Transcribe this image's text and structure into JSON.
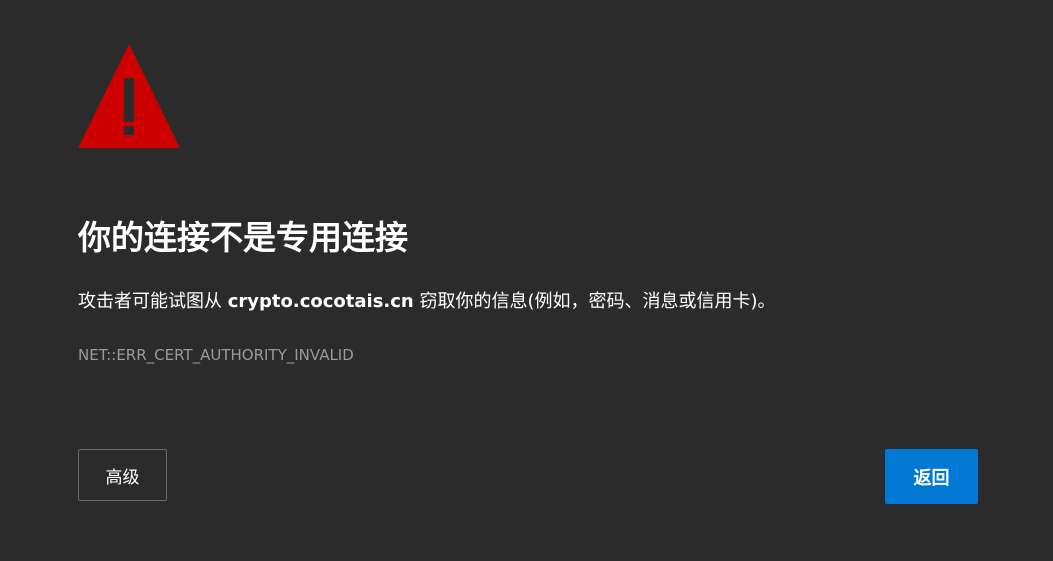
{
  "colors": {
    "background": "#2b2b2b",
    "warning": "#cc0000",
    "accent": "#0078d4",
    "text": "#ffffff",
    "muted_text": "#9a9a9a"
  },
  "icon": "warning-triangle-icon",
  "title": "你的连接不是专用连接",
  "description": {
    "prefix": "攻击者可能试图从 ",
    "domain": "crypto.cocotais.cn",
    "suffix": " 窃取你的信息(例如，密码、消息或信用卡)。"
  },
  "error_code": "NET::ERR_CERT_AUTHORITY_INVALID",
  "buttons": {
    "advanced": "高级",
    "back": "返回"
  }
}
